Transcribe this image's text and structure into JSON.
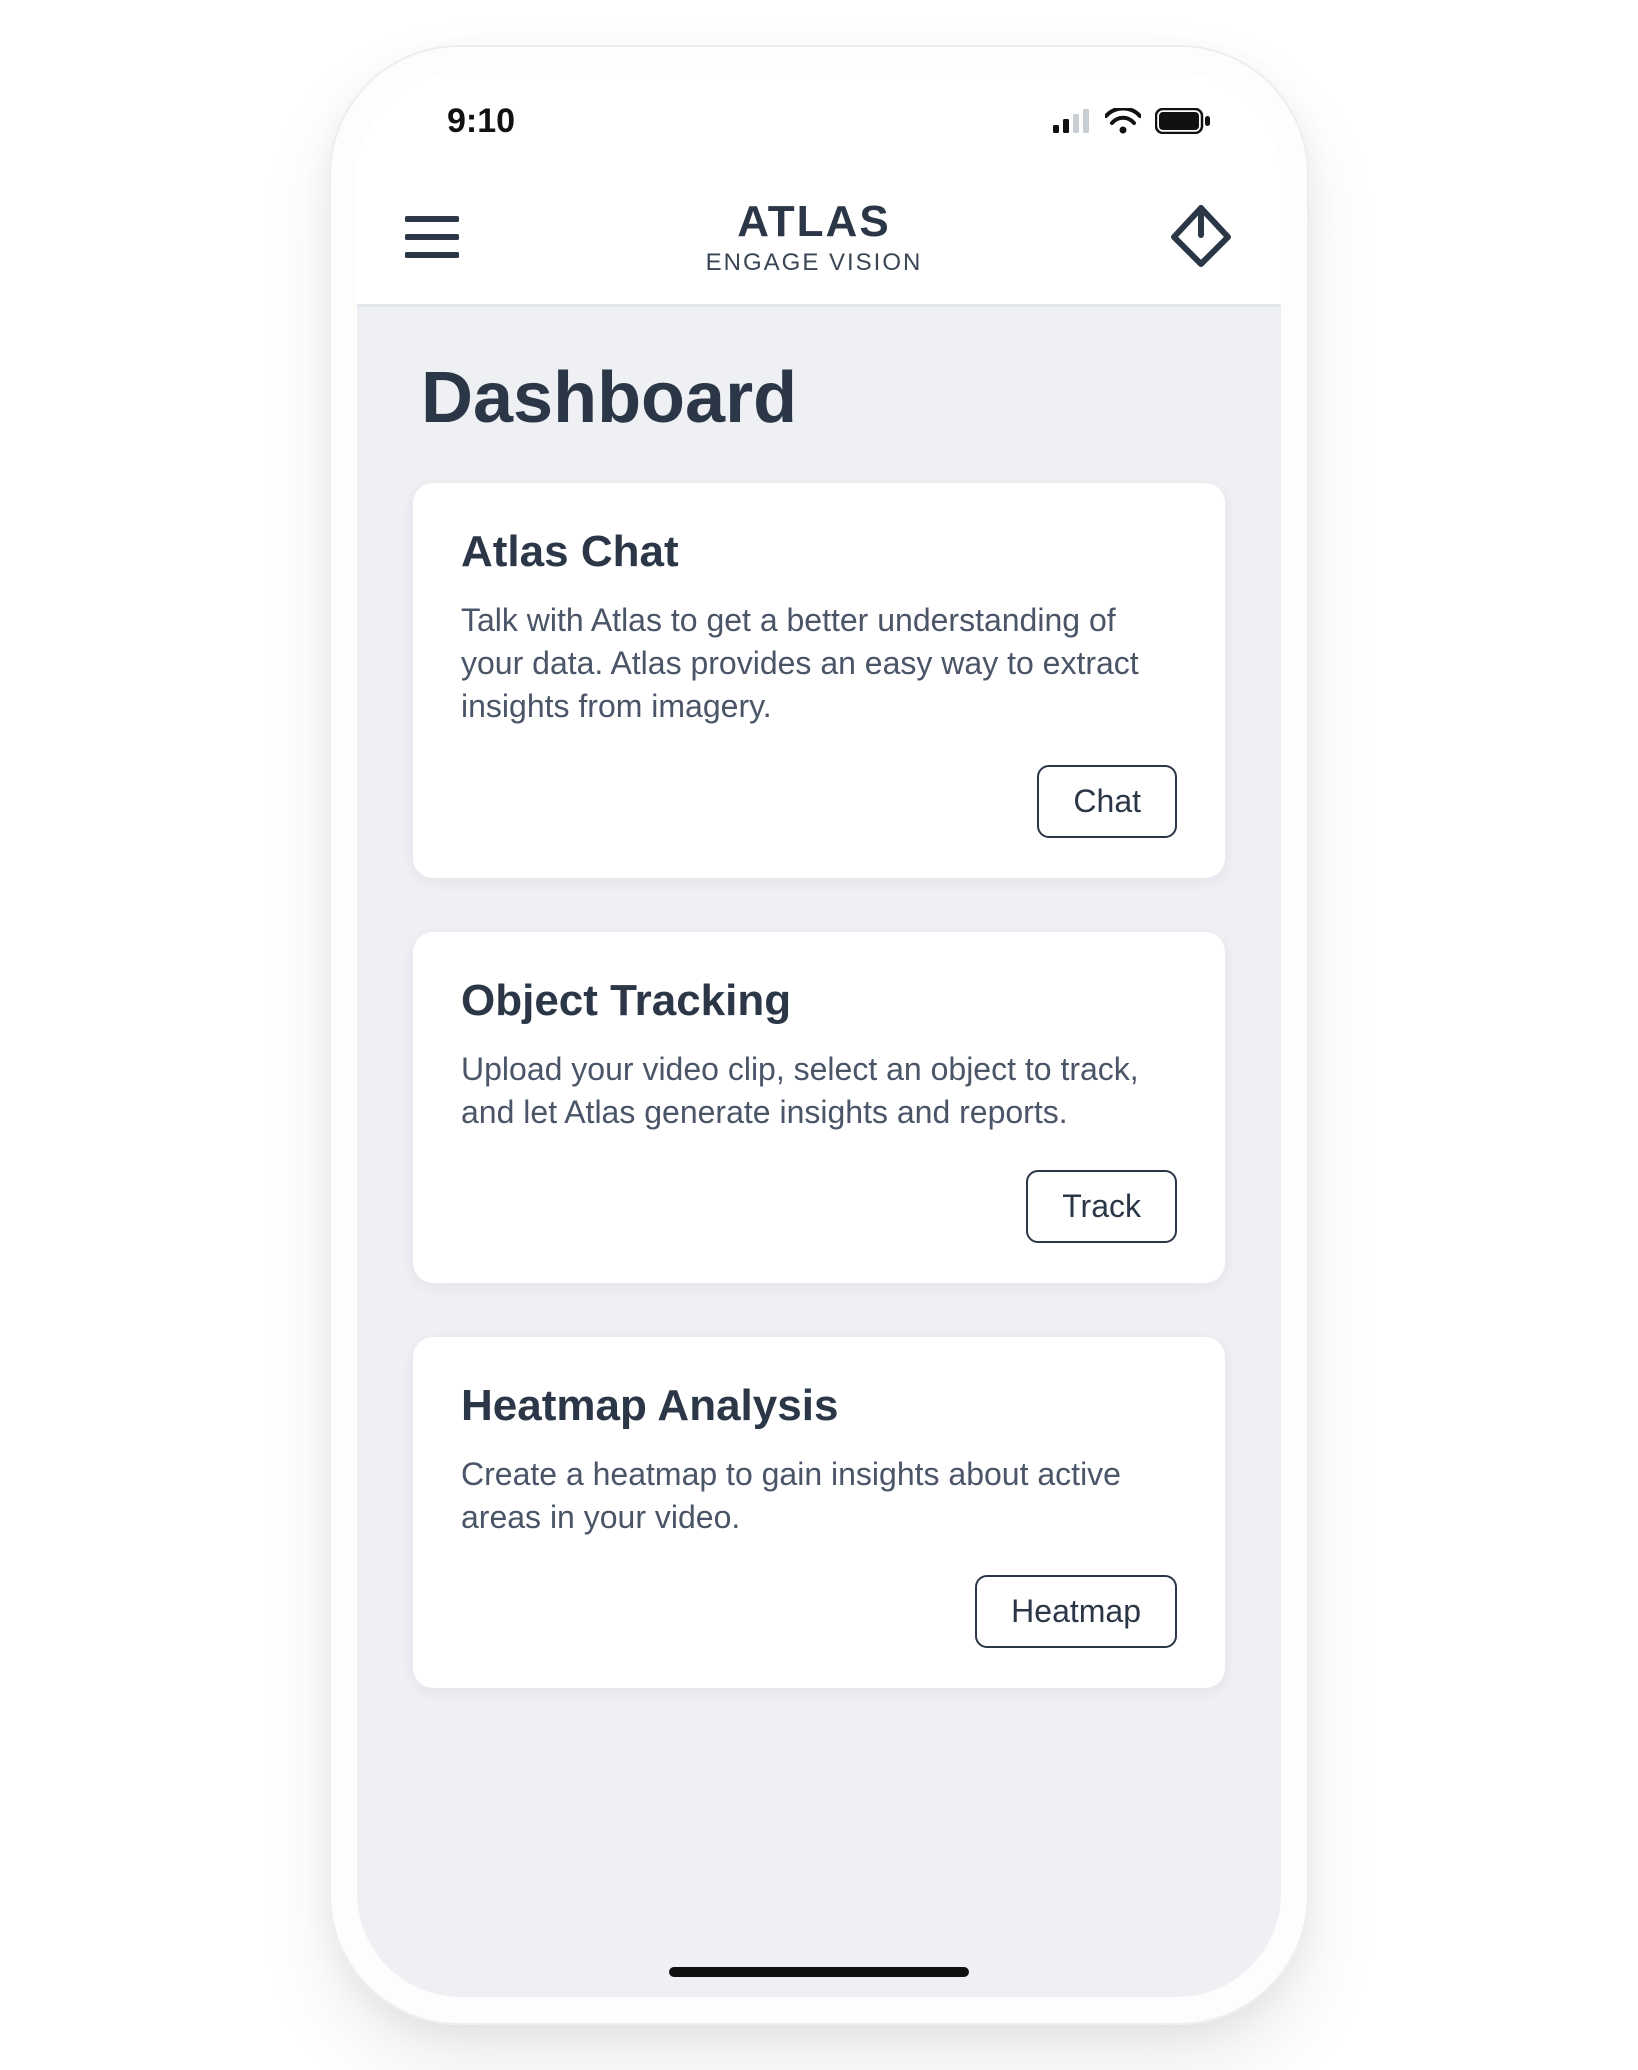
{
  "status": {
    "time": "9:10"
  },
  "header": {
    "app_title": "ATLAS",
    "app_subtitle": "ENGAGE VISION"
  },
  "page": {
    "title": "Dashboard"
  },
  "cards": [
    {
      "title": "Atlas Chat",
      "desc": "Talk with Atlas to get a better understanding of your data. Atlas provides an easy way to extract insights from imagery.",
      "button": "Chat"
    },
    {
      "title": "Object Tracking",
      "desc": "Upload your video clip, select an object to track, and let Atlas generate insights and reports.",
      "button": "Track"
    },
    {
      "title": "Heatmap Analysis",
      "desc": "Create a heatmap to gain insights about active areas in your video.",
      "button": "Heatmap"
    }
  ]
}
